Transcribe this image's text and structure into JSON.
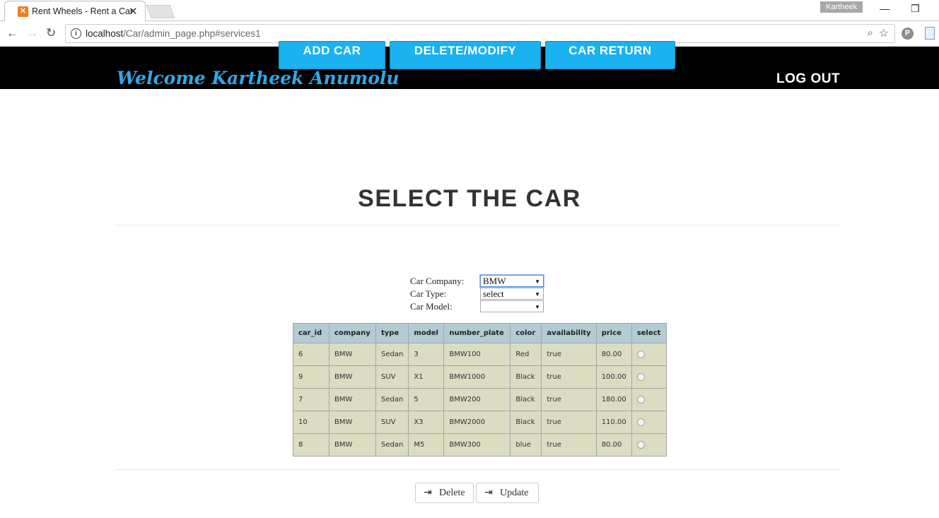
{
  "browser": {
    "tab_title": "Rent Wheels - Rent a Car",
    "tab_close": "✕",
    "favicon": "xampp-icon",
    "profile_name": "Kartheek",
    "url_host": "localhost",
    "url_path": "/Car/admin_page.php#services1",
    "win_minimize": "—",
    "win_restore": "❐",
    "win_close": "✕"
  },
  "header": {
    "buttons": [
      "ADD CAR",
      "DELETE/MODIFY",
      "CAR RETURN"
    ],
    "welcome": "Welcome Kartheek Anumolu",
    "logout": "LOG OUT",
    "accent_color": "#1ab2f0"
  },
  "main": {
    "title": "SELECT THE CAR",
    "filters": {
      "company_label": "Car Company:",
      "company_value": "BMW",
      "type_label": "Car Type:",
      "type_value": "select",
      "model_label": "Car Model:",
      "model_value": ""
    },
    "table": {
      "headers": [
        "car_id",
        "company",
        "type",
        "model",
        "number_plate",
        "color",
        "availability",
        "price",
        "select"
      ],
      "rows": [
        [
          "6",
          "BMW",
          "Sedan",
          "3",
          "BMW100",
          "Red",
          "true",
          "80.00"
        ],
        [
          "9",
          "BMW",
          "SUV",
          "X1",
          "BMW1000",
          "Black",
          "true",
          "100.00"
        ],
        [
          "7",
          "BMW",
          "Sedan",
          "5",
          "BMW200",
          "Black",
          "true",
          "180.00"
        ],
        [
          "10",
          "BMW",
          "SUV",
          "X3",
          "BMW2000",
          "Black",
          "true",
          "110.00"
        ],
        [
          "8",
          "BMW",
          "Sedan",
          "M5",
          "BMW300",
          "blue",
          "true",
          "80.00"
        ]
      ]
    },
    "actions": {
      "delete_label": "Delete",
      "update_label": "Update"
    }
  }
}
